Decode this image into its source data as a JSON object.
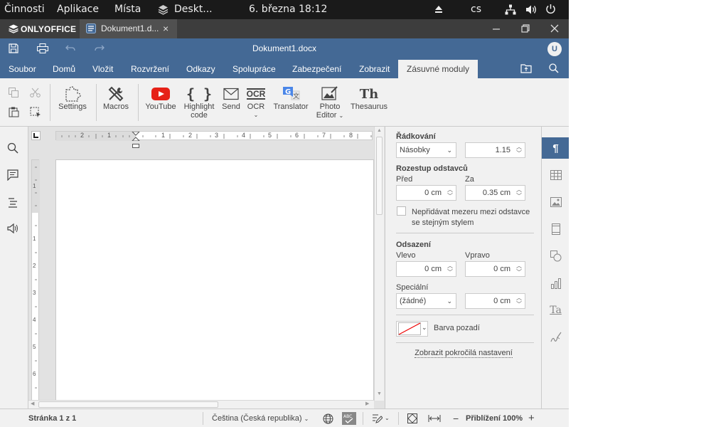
{
  "topbar": {
    "activities": "Činnosti",
    "applications": "Aplikace",
    "places": "Místa",
    "desktop_app": "Deskt...",
    "datetime": "6. března  18:12",
    "keyboard_layout": "cs"
  },
  "tabbar": {
    "brand": "ONLYOFFICE",
    "doc_tab_label": "Dokument1.d...",
    "close_tab": "×"
  },
  "header": {
    "doc_title": "Dokument1.docx",
    "user_initial": "U"
  },
  "menu_tabs": [
    {
      "label": "Soubor"
    },
    {
      "label": "Domů"
    },
    {
      "label": "Vložit"
    },
    {
      "label": "Rozvržení"
    },
    {
      "label": "Odkazy"
    },
    {
      "label": "Spolupráce"
    },
    {
      "label": "Zabezpečení"
    },
    {
      "label": "Zobrazit"
    },
    {
      "label": "Zásuvné moduly"
    }
  ],
  "toolbar": {
    "settings": "Settings",
    "macros": "Macros",
    "youtube": "YouTube",
    "highlight_1": "Highlight",
    "highlight_2": "code",
    "send": "Send",
    "ocr": "OCR",
    "translator": "Translator",
    "photo_1": "Photo",
    "photo_2": "Editor",
    "thesaurus": "Thesaurus",
    "brace_glyph": "{ }",
    "thesaurus_glyph": "Th",
    "ocr_glyph": "OCR"
  },
  "ruler": {
    "h_ticks": [
      "2",
      "1",
      "1",
      "2",
      "3",
      "4",
      "5",
      "6",
      "7",
      "8"
    ],
    "v_ticks": [
      "1",
      "1",
      "2",
      "3",
      "4",
      "5",
      "6"
    ]
  },
  "panel": {
    "line_spacing_heading": "Řádkování",
    "line_spacing_type": "Násobky",
    "line_spacing_value": "1.15",
    "para_spacing_heading": "Rozestup odstavců",
    "before_label": "Před",
    "before_value": "0 cm",
    "after_label": "Za",
    "after_value": "0.35 cm",
    "no_space_1": "Nepřidávat mezeru mezi odstavce",
    "no_space_2": "se stejným stylem",
    "indent_heading": "Odsazení",
    "left_label": "Vlevo",
    "left_value": "0 cm",
    "right_label": "Vpravo",
    "right_value": "0 cm",
    "special_label": "Speciální",
    "special_type": "(žádné)",
    "special_value": "0 cm",
    "bg_color_label": "Barva pozadí",
    "advanced": "Zobrazit pokročilá nastavení"
  },
  "status": {
    "page_info": "Stránka 1 z 1",
    "language": "Čeština (Česká republika)",
    "zoom": "Přiblížení 100%"
  },
  "colors": {
    "header_blue": "#446995",
    "toolbar_bg": "#f1f1f1",
    "topbar_bg": "#1a1a1a",
    "youtube_red": "#e62117",
    "translator_blue": "#4a86e8"
  }
}
